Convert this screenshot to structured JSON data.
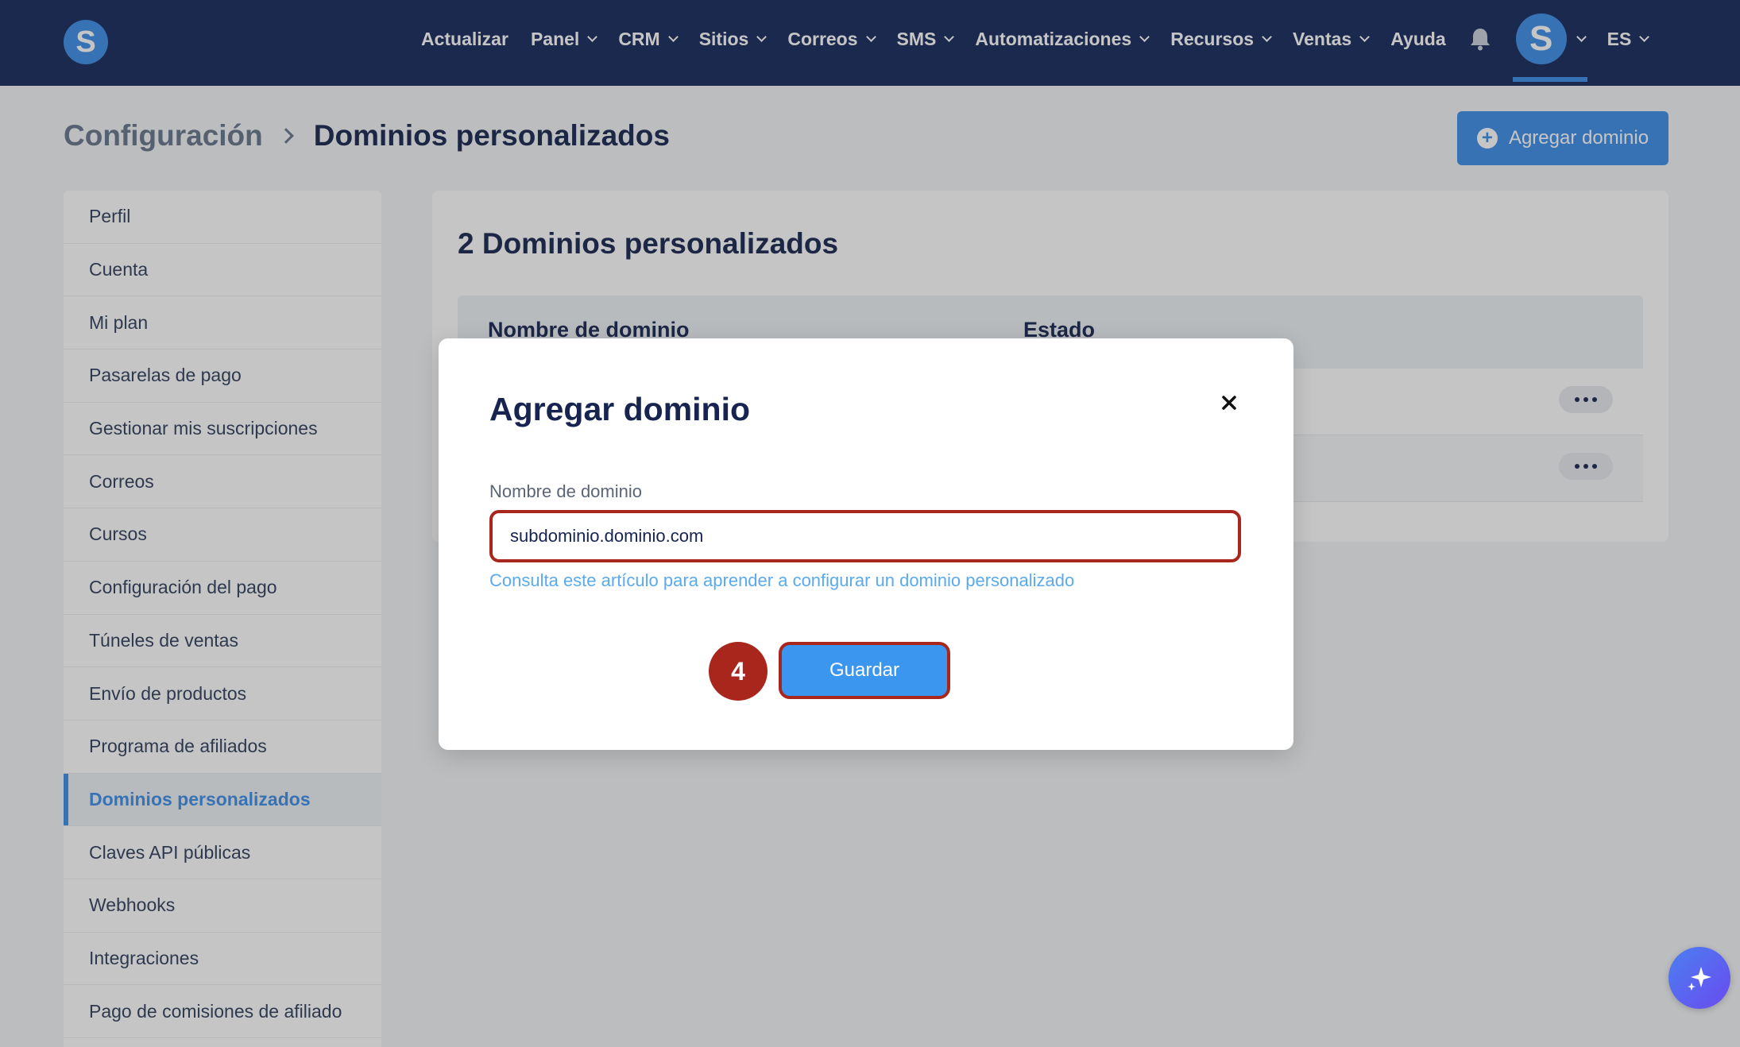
{
  "nav": {
    "logo_letter": "S",
    "items": [
      {
        "label": "Actualizar",
        "dropdown": false
      },
      {
        "label": "Panel",
        "dropdown": true
      },
      {
        "label": "CRM",
        "dropdown": true
      },
      {
        "label": "Sitios",
        "dropdown": true
      },
      {
        "label": "Correos",
        "dropdown": true
      },
      {
        "label": "SMS",
        "dropdown": true
      },
      {
        "label": "Automatizaciones",
        "dropdown": true
      },
      {
        "label": "Recursos",
        "dropdown": true
      },
      {
        "label": "Ventas",
        "dropdown": true
      },
      {
        "label": "Ayuda",
        "dropdown": false
      }
    ],
    "avatar_letter": "S",
    "language": "ES"
  },
  "header": {
    "breadcrumb_root": "Configuración",
    "breadcrumb_current": "Dominios personalizados",
    "add_button": "Agregar dominio"
  },
  "sidebar": {
    "items": [
      {
        "label": "Perfil"
      },
      {
        "label": "Cuenta"
      },
      {
        "label": "Mi plan"
      },
      {
        "label": "Pasarelas de pago"
      },
      {
        "label": "Gestionar mis suscripciones"
      },
      {
        "label": "Correos"
      },
      {
        "label": "Cursos"
      },
      {
        "label": "Configuración del pago"
      },
      {
        "label": "Túneles de ventas"
      },
      {
        "label": "Envío de productos"
      },
      {
        "label": "Programa de afiliados"
      },
      {
        "label": "Dominios personalizados",
        "active": true
      },
      {
        "label": "Claves API públicas"
      },
      {
        "label": "Webhooks"
      },
      {
        "label": "Integraciones"
      },
      {
        "label": "Pago de comisiones de afiliado"
      }
    ]
  },
  "main": {
    "card_title": "2 Dominios personalizados",
    "columns": [
      "Nombre de dominio",
      "Estado"
    ]
  },
  "modal": {
    "title": "Agregar dominio",
    "field_label": "Nombre de dominio",
    "field_value": "subdominio.dominio.com",
    "help_link": "Consulta este artículo para aprender a configurar un dominio personalizado",
    "save_button": "Guardar",
    "step_number": "4"
  },
  "colors": {
    "nav_bg": "#14275c",
    "accent": "#3b8ee8",
    "highlight": "#a8261b"
  }
}
